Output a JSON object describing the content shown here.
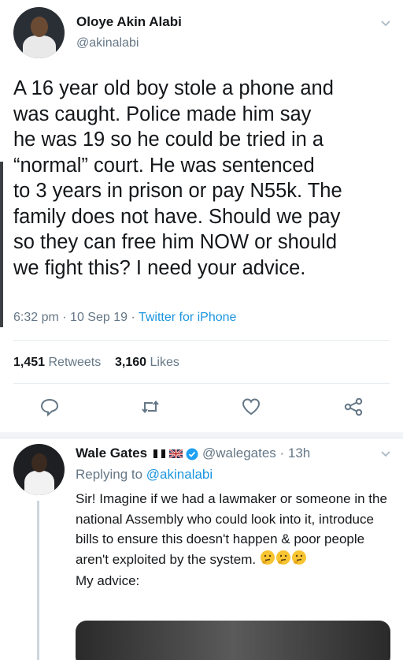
{
  "tweet": {
    "author_name": "Oloye Akin Alabi",
    "author_handle": "@akinalabi",
    "text": "A 16 year old boy stole a phone and\nwas caught. Police made him say\nhe was 19 so he could be tried in a\n“normal” court. He was sentenced\nto 3 years in prison or pay N55k. The\nfamily does not have. Should we pay\nso they can free him NOW or should\nwe fight this? I need your advice.",
    "time": "6:32 pm",
    "date": "10 Sep 19",
    "source": "Twitter for iPhone",
    "retweets_count": "1,451",
    "retweets_label": "Retweets",
    "likes_count": "3,160",
    "likes_label": "Likes"
  },
  "reply": {
    "author_name": "Wale Gates",
    "author_handle": "@walegates",
    "age": "13h",
    "replying_prefix": "Replying to",
    "replying_to": "@akinalabi",
    "text": "Sir! Imagine if we had a lawmaker or someone in the national Assembly who could look into it, introduce bills to ensure this doesn't happen & poor people aren't exploited by the system.",
    "text_2": "My advice:"
  },
  "icons": [
    "chevron-down-icon",
    "reply-icon",
    "retweet-icon",
    "like-icon",
    "share-icon",
    "verified-icon",
    "flag-nigeria-icon",
    "flag-uk-icon",
    "thinking-emoji-icon"
  ],
  "colors": {
    "link": "#1b95e0",
    "secondary": "#657786",
    "text": "#14171a",
    "verified": "#1da1f2"
  }
}
